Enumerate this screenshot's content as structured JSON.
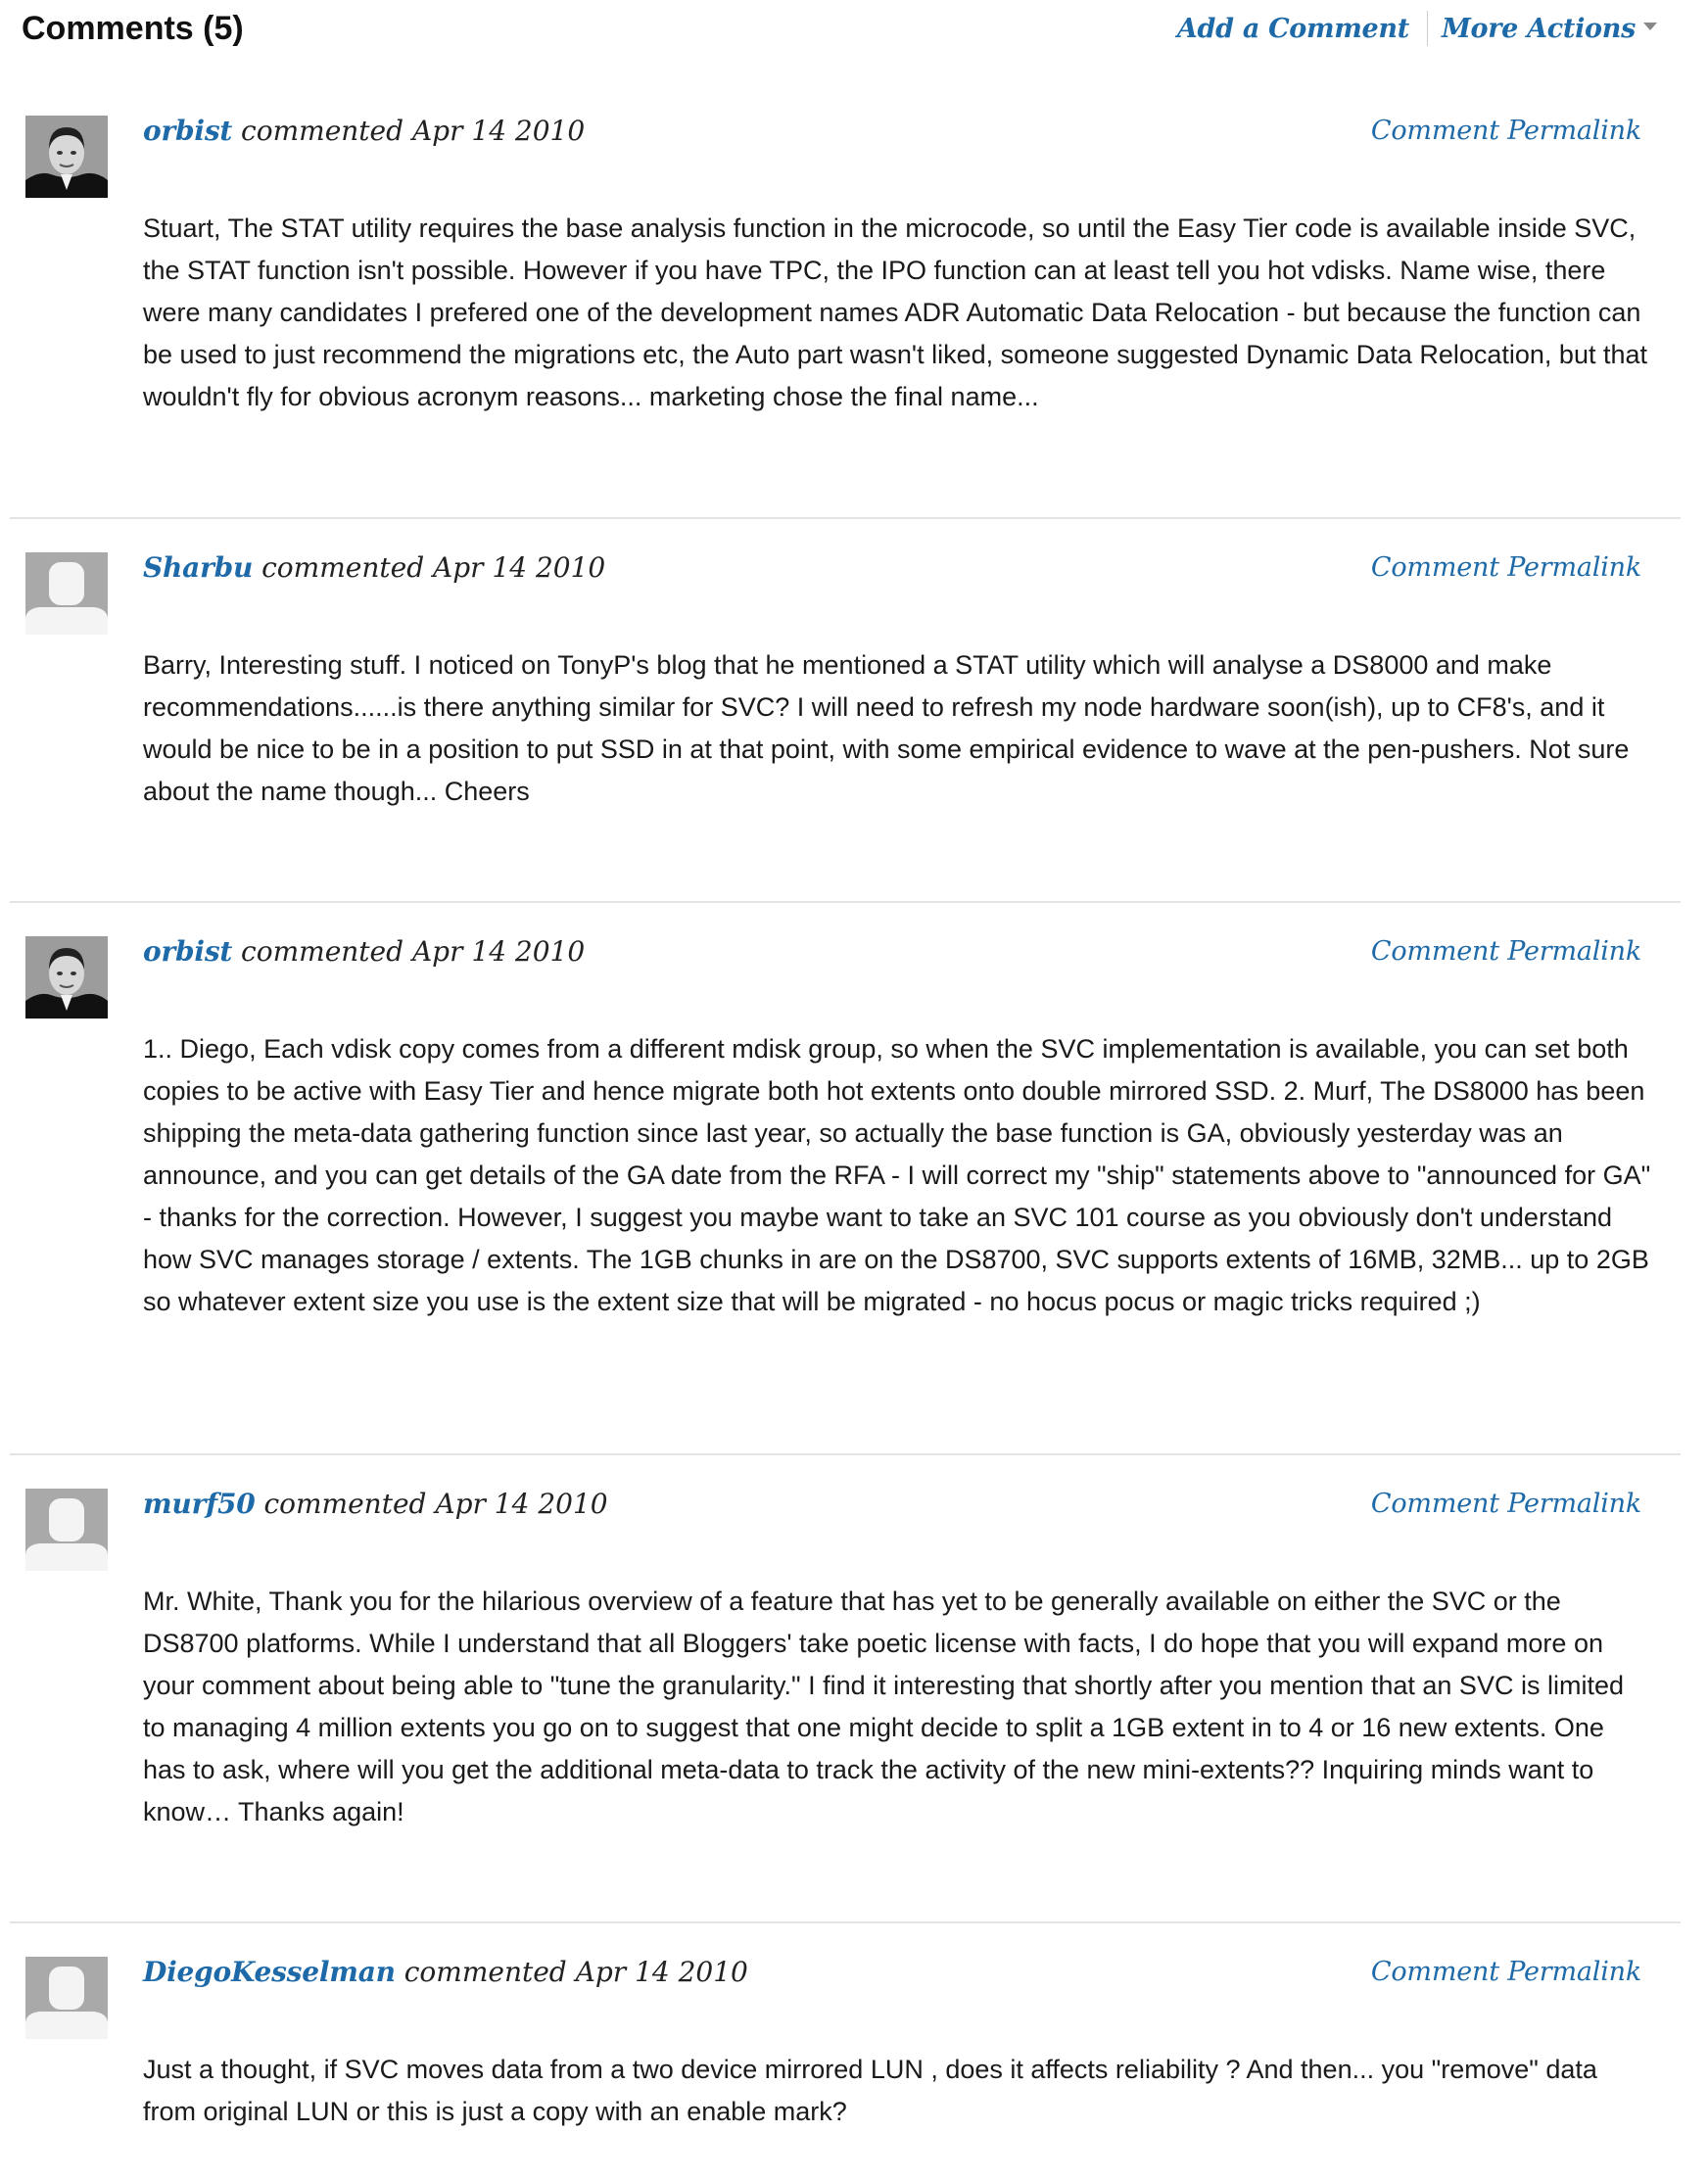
{
  "header": {
    "title": "Comments (5)",
    "add_comment": "Add a Comment",
    "more_actions": "More Actions"
  },
  "icons": {
    "more_actions_chevron": "chevron-down-icon",
    "avatar_photo": "user-photo-avatar",
    "avatar_placeholder": "default-user-avatar-icon"
  },
  "colors": {
    "link": "#1e6aa8",
    "divider": "#e4e4e4",
    "placeholder_avatar": "#a9a9a9"
  },
  "comments": [
    {
      "author": "orbist",
      "action": "commented",
      "date": "Apr 14 2010",
      "permalink": "Comment Permalink",
      "avatar": "photo",
      "body": "Stuart, The STAT utility requires the base analysis function in the microcode, so until the Easy Tier code is available inside SVC, the STAT function isn't possible. However if you have TPC, the IPO function can at least tell you hot vdisks. Name wise, there were many candidates I prefered one of the development names ADR Automatic Data Relocation - but because the function can be used to just recommend the migrations etc, the Auto part wasn't liked, someone suggested Dynamic Data Relocation, but that wouldn't fly for obvious acronym reasons... marketing chose the final name..."
    },
    {
      "author": "Sharbu",
      "action": "commented",
      "date": "Apr 14 2010",
      "permalink": "Comment Permalink",
      "avatar": "placeholder",
      "body": "Barry, Interesting stuff. I noticed on TonyP's blog that he mentioned a STAT utility which will analyse a DS8000 and make recommendations......is there anything similar for SVC? I will need to refresh my node hardware soon(ish), up to CF8's, and it would be nice to be in a position to put SSD in at that point, with some empirical evidence to wave at the pen-pushers. Not sure about the name though... Cheers"
    },
    {
      "author": "orbist",
      "action": "commented",
      "date": "Apr 14 2010",
      "permalink": "Comment Permalink",
      "avatar": "photo",
      "body": "1.. Diego, Each vdisk copy comes from a different mdisk group, so when the SVC implementation is available, you can set both copies to be active with Easy Tier and hence migrate both hot extents onto double mirrored SSD. 2. Murf, The DS8000 has been shipping the meta-data gathering function since last year, so actually the base function is GA, obviously yesterday was an announce, and you can get details of the GA date from the RFA - I will correct my \"ship\" statements above to \"announced for GA\" - thanks for the correction. However, I suggest you maybe want to take an SVC 101 course as you obviously don't understand how SVC manages storage / extents. The 1GB chunks in are on the DS8700, SVC supports extents of 16MB, 32MB... up to 2GB so whatever extent size you use is the extent size that will be migrated - no hocus pocus or magic tricks required ;)"
    },
    {
      "author": "murf50",
      "action": "commented",
      "date": "Apr 14 2010",
      "permalink": "Comment Permalink",
      "avatar": "placeholder",
      "body": "Mr. White, Thank you for the hilarious overview of a feature that has yet to be generally available on either the SVC or the DS8700 platforms. While I understand that all Bloggers' take poetic license with facts, I do hope that you will expand more on your comment about being able to \"tune the granularity.\" I find it interesting that shortly after you mention that an SVC is limited to managing 4 million extents you go on to suggest that one might decide to split a 1GB extent in to 4 or 16 new extents. One has to ask, where will you get the additional meta-data to track the activity of the new mini-extents?? Inquiring minds want to know… Thanks again!"
    },
    {
      "author": "DiegoKesselman",
      "action": "commented",
      "date": "Apr 14 2010",
      "permalink": "Comment Permalink",
      "avatar": "placeholder",
      "body": "Just a thought, if SVC moves data from a two device mirrored LUN , does it affects reliability ? And then... you \"remove\" data from original LUN or this is just a copy with an enable mark?"
    }
  ]
}
